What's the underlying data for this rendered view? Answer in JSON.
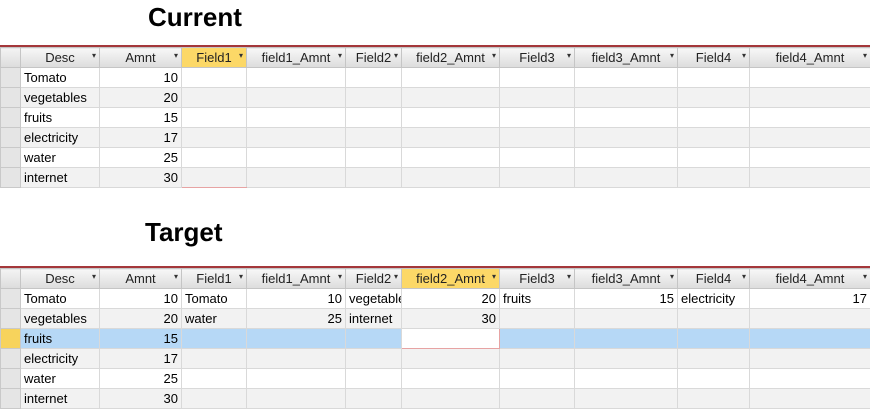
{
  "labels": {
    "current": "Current",
    "target": "Target"
  },
  "columns": [
    "Desc",
    "Amnt",
    "Field1",
    "field1_Amnt",
    "Field2",
    "field2_Amnt",
    "Field3",
    "field3_Amnt",
    "Field4",
    "field4_Amnt"
  ],
  "current": {
    "selected_column": "Field1",
    "rows": [
      [
        "Tomato",
        "10",
        "",
        "",
        "",
        "",
        "",
        "",
        "",
        ""
      ],
      [
        "vegetables",
        "20",
        "",
        "",
        "",
        "",
        "",
        "",
        "",
        ""
      ],
      [
        "fruits",
        "15",
        "",
        "",
        "",
        "",
        "",
        "",
        "",
        ""
      ],
      [
        "electricity",
        "17",
        "",
        "",
        "",
        "",
        "",
        "",
        "",
        ""
      ],
      [
        "water",
        "25",
        "",
        "",
        "",
        "",
        "",
        "",
        "",
        ""
      ],
      [
        "internet",
        "30",
        "",
        "",
        "",
        "",
        "",
        "",
        "",
        ""
      ]
    ]
  },
  "target": {
    "selected_column": "field2_Amnt",
    "selected_row": 3,
    "rows": [
      [
        "Tomato",
        "10",
        "Tomato",
        "10",
        "vegetables",
        "20",
        "fruits",
        "15",
        "electricity",
        "17"
      ],
      [
        "vegetables",
        "20",
        "water",
        "25",
        "internet",
        "30",
        "",
        "",
        "",
        ""
      ],
      [
        "fruits",
        "15",
        "",
        "",
        "",
        "",
        "",
        "",
        "",
        ""
      ],
      [
        "electricity",
        "17",
        "",
        "",
        "",
        "",
        "",
        "",
        "",
        ""
      ],
      [
        "water",
        "25",
        "",
        "",
        "",
        "",
        "",
        "",
        "",
        ""
      ],
      [
        "internet",
        "30",
        "",
        "",
        "",
        "",
        "",
        "",
        "",
        ""
      ]
    ]
  }
}
